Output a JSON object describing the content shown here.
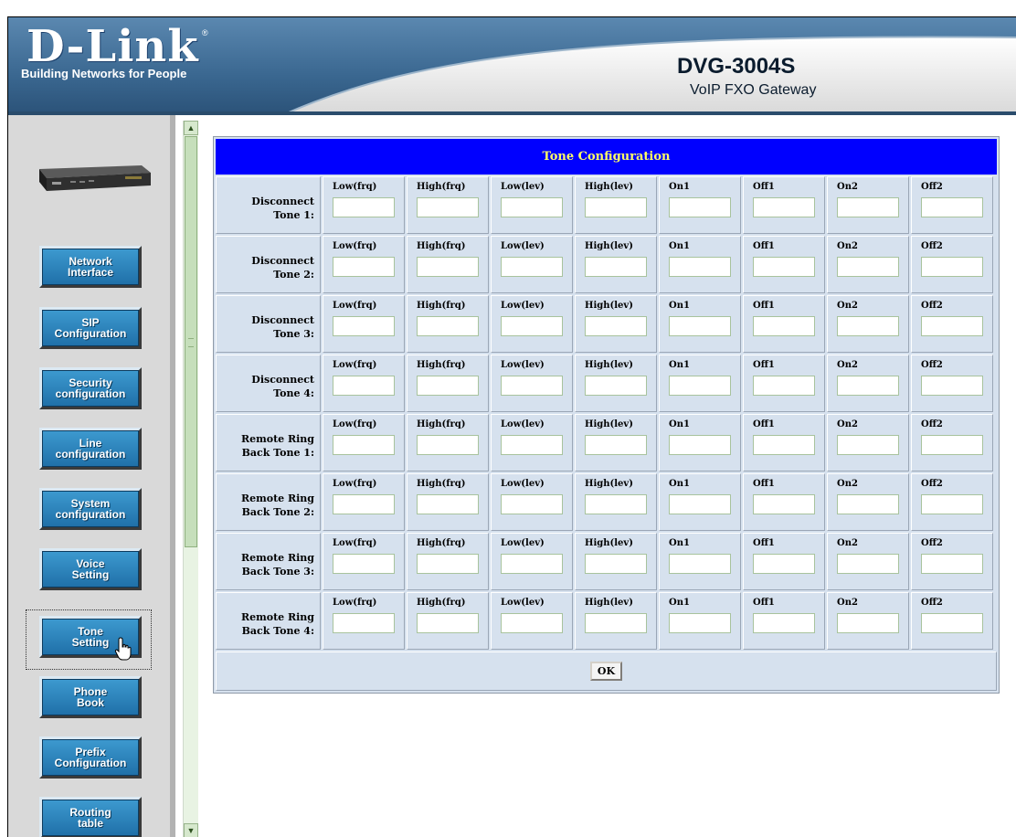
{
  "header": {
    "logo_text": "D-Link",
    "logo_registered": "®",
    "tagline": "Building Networks for People",
    "model": "DVG-3004S",
    "subtitle": "VoIP FXO Gateway"
  },
  "colors": {
    "header_blue": "#3a6a96",
    "title_bar": "#0000ff",
    "title_text": "#ffff66",
    "table_bg": "#d6e1ee",
    "nav_button": "#2b86c0",
    "sidebar_bg": "#d9d9d9"
  },
  "sidebar": {
    "items": [
      {
        "label": "Network\nInterface"
      },
      {
        "label": "SIP\nConfiguration"
      },
      {
        "label": "Security\nconfiguration"
      },
      {
        "label": "Line\nconfiguration"
      },
      {
        "label": "System\nconfiguration"
      },
      {
        "label": "Voice\nSetting"
      },
      {
        "label": "Tone\nSetting"
      },
      {
        "label": "Phone\nBook"
      },
      {
        "label": "Prefix\nConfiguration"
      },
      {
        "label": "Routing\ntable"
      }
    ],
    "selected": "Tone Setting"
  },
  "scrollbar": {
    "up_icon": "scroll-up-arrow-icon",
    "down_icon": "scroll-down-arrow-icon"
  },
  "main": {
    "title": "Tone Configuration",
    "field_labels": [
      "Low(frq)",
      "High(frq)",
      "Low(lev)",
      "High(lev)",
      "On1",
      "Off1",
      "On2",
      "Off2"
    ],
    "rows": [
      {
        "label": "Disconnect\nTone 1:"
      },
      {
        "label": "Disconnect\nTone 2:"
      },
      {
        "label": "Disconnect\nTone 3:"
      },
      {
        "label": "Disconnect\nTone 4:"
      },
      {
        "label": "Remote Ring\nBack Tone 1:"
      },
      {
        "label": "Remote Ring\nBack Tone 2:"
      },
      {
        "label": "Remote Ring\nBack Tone 3:"
      },
      {
        "label": "Remote Ring\nBack Tone 4:"
      }
    ],
    "ok_label": "OK"
  }
}
